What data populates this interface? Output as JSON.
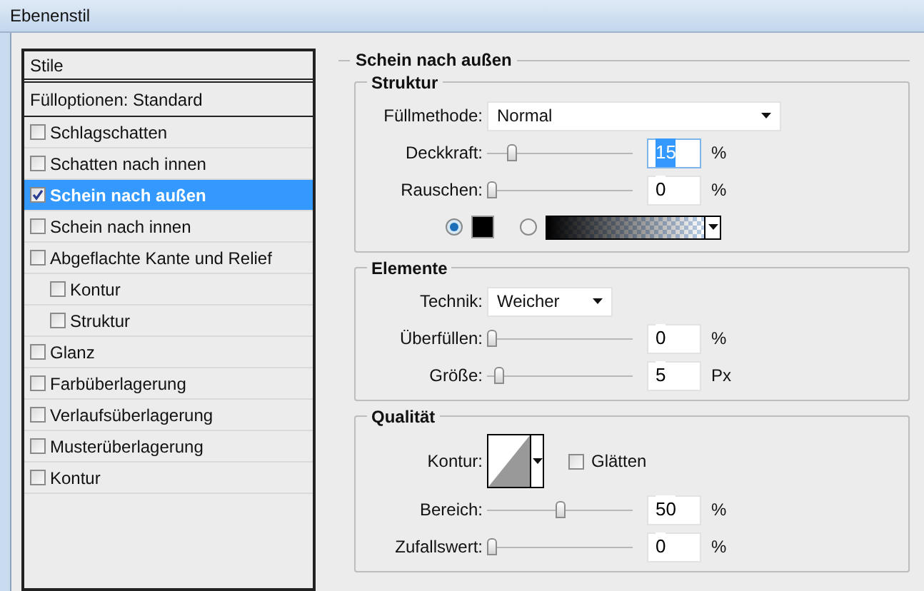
{
  "window": {
    "title": "Ebenenstil"
  },
  "styles_panel": {
    "header": "Stile",
    "blend_options": "Fülloptionen: Standard",
    "items": [
      {
        "label": "Schlagschatten",
        "checked": false,
        "selected": false
      },
      {
        "label": "Schatten nach innen",
        "checked": false,
        "selected": false
      },
      {
        "label": "Schein nach außen",
        "checked": true,
        "selected": true
      },
      {
        "label": "Schein nach innen",
        "checked": false,
        "selected": false
      },
      {
        "label": "Abgeflachte Kante und Relief",
        "checked": false,
        "selected": false,
        "children": [
          {
            "label": "Kontur",
            "checked": false,
            "selected": false
          },
          {
            "label": "Struktur",
            "checked": false,
            "selected": false
          }
        ]
      },
      {
        "label": "Glanz",
        "checked": false,
        "selected": false
      },
      {
        "label": "Farbüberlagerung",
        "checked": false,
        "selected": false
      },
      {
        "label": "Verlaufsüberlagerung",
        "checked": false,
        "selected": false
      },
      {
        "label": "Musterüberlagerung",
        "checked": false,
        "selected": false
      },
      {
        "label": "Kontur",
        "checked": false,
        "selected": false
      }
    ]
  },
  "panel": {
    "title": "Schein nach außen",
    "groups": [
      {
        "title": "Struktur",
        "rows": [
          {
            "kind": "select",
            "label": "Füllmethode:",
            "value": "Normal"
          },
          {
            "kind": "slider",
            "label": "Deckkraft:",
            "level": 0.15,
            "value": "15",
            "unit": "%",
            "text_selected": true
          },
          {
            "kind": "slider",
            "label": "Rauschen:",
            "level": 0,
            "value": "0",
            "unit": "%",
            "text_selected": false
          },
          {
            "kind": "fill_source",
            "options": [
              {
                "kind": "color",
                "selected": true
              },
              {
                "kind": "gradient",
                "selected": false
              }
            ]
          }
        ]
      },
      {
        "title": "Elemente",
        "rows": [
          {
            "kind": "short_select",
            "label": "Technik:",
            "value": "Weicher"
          },
          {
            "kind": "slider",
            "label": "Überfüllen:",
            "level": 0,
            "value": "0",
            "unit": "%",
            "text_selected": false
          },
          {
            "kind": "slider",
            "label": "Größe:",
            "level": 0.05,
            "value": "5",
            "unit": "Px",
            "text_selected": false
          }
        ]
      },
      {
        "title": "Qualität",
        "rows": [
          {
            "kind": "contour",
            "label": "Kontur:",
            "checkbox": {
              "label": "Glätten",
              "checked": false
            }
          },
          {
            "kind": "slider",
            "label": "Bereich:",
            "level": 0.5,
            "value": "50",
            "unit": "%",
            "text_selected": false
          },
          {
            "kind": "slider",
            "label": "Zufallswert:",
            "level": 0,
            "value": "0",
            "unit": "%",
            "text_selected": false
          }
        ]
      }
    ]
  }
}
